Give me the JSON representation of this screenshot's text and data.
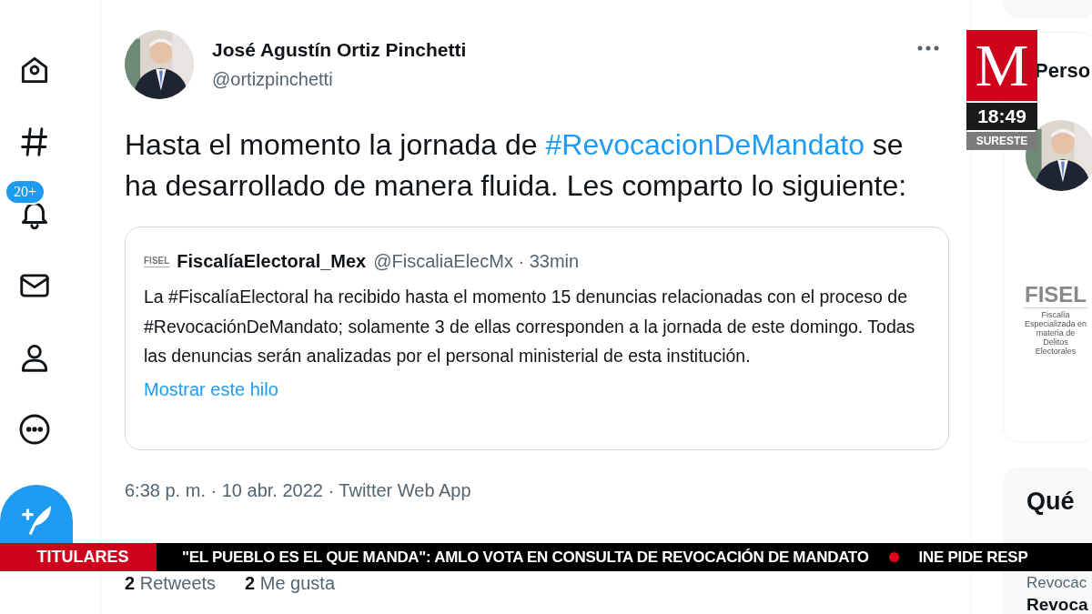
{
  "sidebar": {
    "notification_badge": "20+"
  },
  "tweet": {
    "author_name": "José Agustín Ortiz Pinchetti",
    "handle": "@ortizpinchetti",
    "text": [
      {
        "kind": "text",
        "value": "Hasta el momento la jornada de "
      },
      {
        "kind": "hashtag",
        "value": "#RevocacionDeMandato"
      },
      {
        "kind": "text",
        "value": " se ha desarrollado de manera fluida. Les comparto lo siguiente:"
      }
    ],
    "quoted": {
      "avatar_text": "FISEL",
      "author_name": "FiscalíaElectoral_Mex",
      "meta": "@FiscaliaElecMx · 33min",
      "text": "La #FiscalíaElectoral ha recibido hasta el momento 15 denuncias relacionadas con el proceso de #RevocaciónDeMandato; solamente 3 de ellas corresponden a la jornada de este domingo. Todas las denuncias serán analizadas por el personal ministerial de esta institución.",
      "show_thread": "Mostrar este hilo"
    },
    "timestamp": "6:38 p. m. · 10 abr. 2022 · Twitter Web App",
    "stats": [
      {
        "count": "2",
        "label": "Retweets"
      },
      {
        "count": "2",
        "label": "Me gusta"
      }
    ]
  },
  "right_column": {
    "section_title": "Perso",
    "logo_title": "FISEL",
    "logo_subtitle": "Fiscalía Especializada en materia de Delitos Electorales",
    "trends_title": "Qué",
    "trend_items": [
      {
        "kind": "context",
        "text": "Revocac"
      },
      {
        "kind": "name",
        "text": "Revoca"
      }
    ]
  },
  "broadcast": {
    "logo_letter": "M",
    "clock": "18:49",
    "region": "SURESTE",
    "ticker": {
      "label": "TITULARES",
      "headlines": [
        "\"EL PUEBLO ES EL QUE MANDA\": AMLO VOTA EN CONSULTA DE REVOCACIÓN DE MANDATO",
        "INE PIDE RESP"
      ]
    }
  }
}
